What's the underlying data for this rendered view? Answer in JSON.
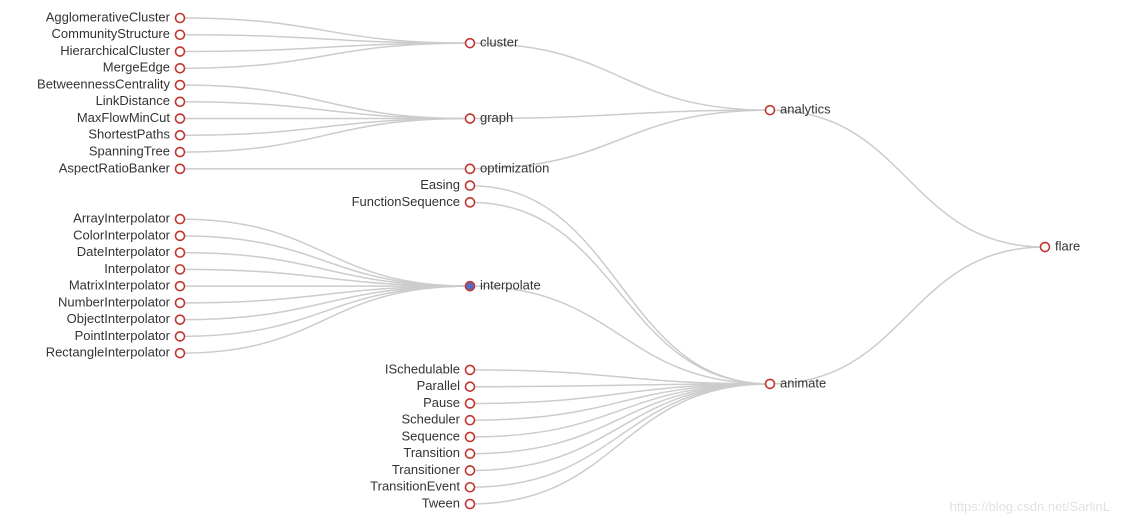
{
  "chart_data": {
    "type": "tree",
    "direction": "rtl",
    "root": {
      "name": "flare",
      "children": [
        {
          "name": "analytics",
          "children": [
            {
              "name": "cluster",
              "children": [
                {
                  "name": "AgglomerativeCluster"
                },
                {
                  "name": "CommunityStructure"
                },
                {
                  "name": "HierarchicalCluster"
                },
                {
                  "name": "MergeEdge"
                }
              ]
            },
            {
              "name": "graph",
              "children": [
                {
                  "name": "BetweennessCentrality"
                },
                {
                  "name": "LinkDistance"
                },
                {
                  "name": "MaxFlowMinCut"
                },
                {
                  "name": "ShortestPaths"
                },
                {
                  "name": "SpanningTree"
                }
              ]
            },
            {
              "name": "optimization",
              "children": [
                {
                  "name": "AspectRatioBanker"
                }
              ]
            }
          ]
        },
        {
          "name": "animate",
          "children": [
            {
              "name": "Easing"
            },
            {
              "name": "FunctionSequence"
            },
            {
              "name": "interpolate",
              "highlight": true,
              "children": [
                {
                  "name": "ArrayInterpolator"
                },
                {
                  "name": "ColorInterpolator"
                },
                {
                  "name": "DateInterpolator"
                },
                {
                  "name": "Interpolator"
                },
                {
                  "name": "MatrixInterpolator"
                },
                {
                  "name": "NumberInterpolator"
                },
                {
                  "name": "ObjectInterpolator"
                },
                {
                  "name": "PointInterpolator"
                },
                {
                  "name": "RectangleInterpolator"
                }
              ]
            },
            {
              "name": "ISchedulable"
            },
            {
              "name": "Parallel"
            },
            {
              "name": "Pause"
            },
            {
              "name": "Scheduler"
            },
            {
              "name": "Sequence"
            },
            {
              "name": "Transition"
            },
            {
              "name": "Transitioner"
            },
            {
              "name": "TransitionEvent"
            },
            {
              "name": "Tween"
            }
          ]
        }
      ]
    }
  },
  "watermark": "https://blog.csdn.net/SarlinL"
}
